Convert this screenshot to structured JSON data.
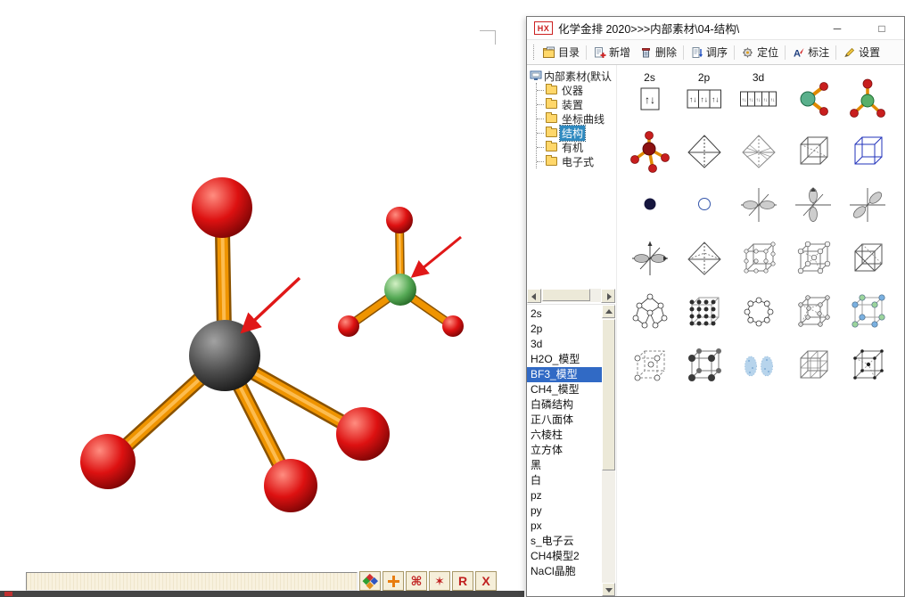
{
  "window": {
    "logo": "HX",
    "title": "化学金排 2020>>>内部素材\\04-结构\\",
    "minimize_glyph": "─",
    "maximize_glyph": "□"
  },
  "toolbar": {
    "items": [
      "目录",
      "新增",
      "删除",
      "调序",
      "定位",
      "标注",
      "设置"
    ],
    "note_letter": "A"
  },
  "tree": {
    "root": "内部素材(默认",
    "items": [
      "仪器",
      "装置",
      "坐标曲线",
      "结构",
      "有机",
      "电子式"
    ],
    "selected": "结构"
  },
  "list": {
    "items": [
      "2s",
      "2p",
      "3d",
      "H2O_模型",
      "BF3_模型",
      "CH4_模型",
      "白磷结构",
      "正八面体",
      "六棱柱",
      "立方体",
      "黑",
      "白",
      "pz",
      "py",
      "px",
      "s_电子云",
      "CH4模型2",
      "NaCl晶胞"
    ],
    "selected": "BF3_模型"
  },
  "thumbs": {
    "labels": [
      "2s",
      "2p",
      "3d"
    ],
    "electron_pair": "↑↓",
    "names": [
      "2s-orbital-box",
      "2p-orbital-boxes",
      "3d-orbital-boxes",
      "h2o-model",
      "bf3-model",
      "ch4-model",
      "octahedron",
      "octahedron-shaded",
      "cube-with-diagonals",
      "blue-cube",
      "solid-sphere",
      "hollow-sphere",
      "p-orbital-x",
      "p-orbital-z",
      "p-orbital-diagonal",
      "p-orbital-axes",
      "octahedron-dashed",
      "crystal-lattice-1",
      "crystal-lattice-2",
      "cube-cross",
      "cage-molecule",
      "packed-lattice",
      "ring-molecule",
      "diamond-lattice",
      "nacl-cell",
      "dashed-cube-atoms",
      "cscl-cell",
      "electron-clouds",
      "stacked-lattice",
      "bcc-cell"
    ]
  },
  "bottom": {
    "input_value": "",
    "buttons": {
      "command": "⌘",
      "star": "✶",
      "r": "R",
      "x": "X"
    }
  },
  "colors": {
    "bond": "#ef9400",
    "atom_red": "#dd1111",
    "atom_dark": "#4c4c4c",
    "atom_green": "#54a854",
    "arrow": "#e01818",
    "list_selection": "#316ac5",
    "tree_selection": "#2f8ac0"
  }
}
